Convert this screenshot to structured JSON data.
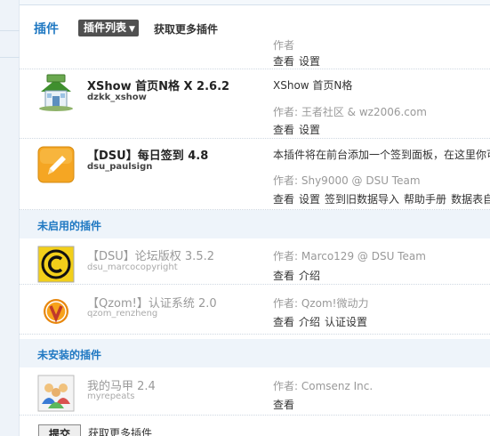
{
  "header": {
    "title": "插件",
    "list_button": "插件列表",
    "caret": "▼",
    "get_more": "获取更多插件"
  },
  "top_partial": {
    "links": [
      "查看",
      "设置"
    ]
  },
  "enabled_plugins": [
    {
      "name": "XShow 首页N格  X 2.6.2",
      "id": "dzkk_xshow",
      "description": "XShow 首页N格",
      "author": "作者: 王者社区 & wz2006.com",
      "links": [
        "查看",
        "设置"
      ]
    },
    {
      "name": "【DSU】每日签到  4.8",
      "id": "dsu_paulsign",
      "description": "本插件将在前台添加一个签到面板，在这里你可",
      "author": "作者: Shy9000 @ DSU Team",
      "links": [
        "查看",
        "设置",
        "签到旧数据导入",
        "帮助手册",
        "数据表自"
      ]
    }
  ],
  "disabled_section": {
    "title": "未启用的插件"
  },
  "disabled_plugins": [
    {
      "name": "【DSU】论坛版权  3.5.2",
      "id": "dsu_marcocopyright",
      "author": "作者: Marco129 @ DSU Team",
      "links": [
        "查看",
        "介绍"
      ]
    },
    {
      "name": "【Qzom!】认证系统  2.0",
      "id": "qzom_renzheng",
      "author": "作者: Qzom!微动力",
      "links": [
        "查看",
        "介绍",
        "认证设置"
      ]
    }
  ],
  "uninstalled_section": {
    "title": "未安装的插件"
  },
  "uninstalled_plugins": [
    {
      "name": "我的马甲  2.4",
      "id": "myrepeats",
      "author": "作者: Comsenz Inc.",
      "links": [
        "查看"
      ]
    }
  ],
  "footer": {
    "submit_label": "提交",
    "more_label": "获取更多插件"
  },
  "colors": {
    "accent": "#1f78c2",
    "section_bg": "#eef4fa"
  }
}
